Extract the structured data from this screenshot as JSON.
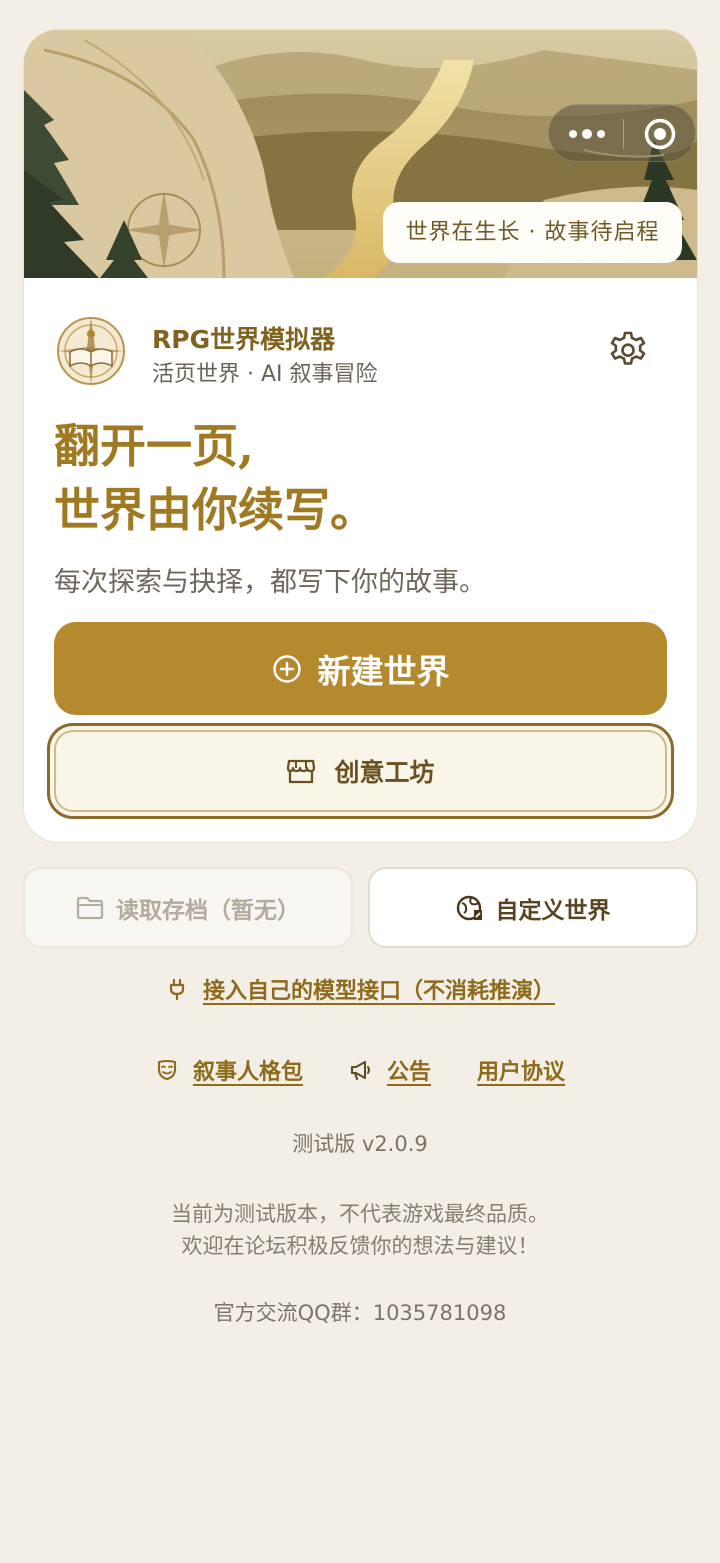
{
  "hero": {
    "pill_text": "世界在生长 · 故事待启程",
    "icons": [
      "more-dots-icon",
      "record-target-icon"
    ]
  },
  "app": {
    "name": "RPG世界模拟器",
    "tagline": "活页世界 · AI 叙事冒险",
    "logo_icon": "compass-book-logo",
    "settings_icon": "gear-icon"
  },
  "headline": {
    "line1": "翻开一页,",
    "line2": "世界由你续写。"
  },
  "subline": "每次探索与抉择，都写下你的故事。",
  "actions": {
    "new_world": "新建世界",
    "workshop": "创意工坊",
    "load_save": "读取存档（暂无）",
    "custom_world": "自定义世界"
  },
  "links": {
    "model_api": "接入自己的模型接口（不消耗推演）",
    "narrator_pack": "叙事人格包",
    "announcement": "公告",
    "user_agreement": "用户协议"
  },
  "footer": {
    "version": "测试版 v2.0.9",
    "notice_line1": "当前为测试版本，不代表游戏最终品质。",
    "notice_line2": "欢迎在论坛积极反馈你的想法与建议！",
    "qq_group": "官方交流QQ群：1035781098"
  },
  "colors": {
    "accent": "#b58a2f",
    "headline": "#a07a22",
    "background": "#f3efe6",
    "link": "#8e6a1c"
  }
}
